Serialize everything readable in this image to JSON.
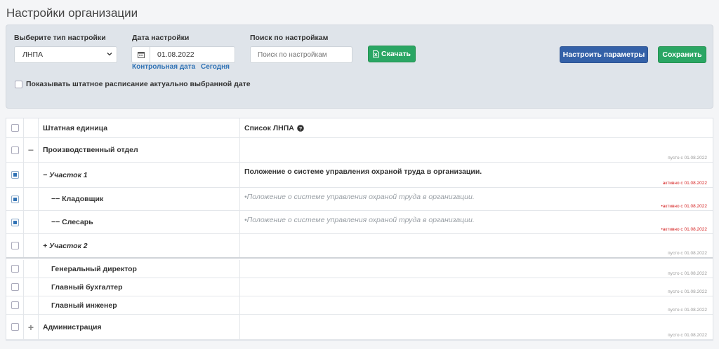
{
  "page": {
    "title": "Настройки организации"
  },
  "filters": {
    "type_label": "Выберите тип настройки",
    "type_value": "ЛНПА",
    "date_label": "Дата настройки",
    "date_value": "01.08.2022",
    "control_date_link": "Контрольная дата",
    "today_link": "Сегодня",
    "search_label": "Поиск по настройкам",
    "search_placeholder": "Поиск по настройкам",
    "download_label": "Скачать",
    "configure_label": "Настроить параметры",
    "save_label": "Сохранить",
    "show_staff_label": "Показывать штатное расписание актуально выбранной дате",
    "show_staff_checked": false
  },
  "table": {
    "col_unit": "Штатная единица",
    "col_list": "Список ЛНПА",
    "rows": [
      {
        "expander": "−",
        "name": "Производственный отдел",
        "doc": "",
        "status": "пусто с 01.08.2022",
        "checked": false
      },
      {
        "expander": "",
        "name": "− Участок 1",
        "doc": "Положение о системе управления охраной труда в организации.",
        "status": "активно с 01.08.2022",
        "checked": true
      },
      {
        "expander": "",
        "name": "−− Кладовщик",
        "doc": "•Положение о системе управления охраной труда в организации.",
        "status": "•активно с 01.08.2022",
        "checked": true
      },
      {
        "expander": "",
        "name": "−− Слесарь",
        "doc": "•Положение о системе управления охраной труда в организации.",
        "status": "•активно с 01.08.2022",
        "checked": true
      },
      {
        "expander": "",
        "name": "+ Участок 2",
        "doc": "",
        "status": "пусто с 01.08.2022",
        "checked": false
      },
      {
        "expander": "",
        "name": "Генеральный директор",
        "doc": "",
        "status": "пусто с 01.08.2022",
        "checked": false
      },
      {
        "expander": "",
        "name": "Главный бухгалтер",
        "doc": "",
        "status": "пусто с 01.08.2022",
        "checked": false
      },
      {
        "expander": "",
        "name": "Главный инженер",
        "doc": "",
        "status": "пусто с 01.08.2022",
        "checked": false
      },
      {
        "expander": "+",
        "name": "Администрация",
        "doc": "",
        "status": "пусто с 01.08.2022",
        "checked": false
      }
    ]
  },
  "colors": {
    "green": "#2aa664",
    "blue": "#3461a8",
    "link": "#2f72b5",
    "active_status": "#d42020"
  }
}
